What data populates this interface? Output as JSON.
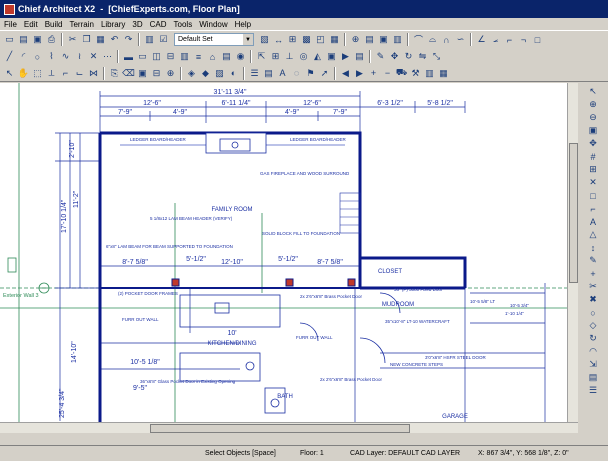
{
  "window": {
    "title": "Chief Architect X2",
    "title_suffix": "[ChiefExperts.com, Floor Plan]",
    "colors": {
      "titlebar": "#0a246a",
      "plan_lines": "#1b2fa3",
      "walls": "#0b1a8a",
      "dimensions": "#1b2fa3",
      "green_guides": "#2e8b57",
      "red_marker": "#c0392b"
    }
  },
  "menu": [
    "File",
    "Edit",
    "Build",
    "Terrain",
    "Library",
    "3D",
    "CAD",
    "Tools",
    "Window",
    "Help"
  ],
  "toolbar": {
    "layer_select": "Default Set"
  },
  "plan": {
    "dimensions_top": {
      "overall": "31'-11 3/4\"",
      "row2_left": "12'-6\"",
      "row2_mid": "6'-11 1/4\"",
      "row2_right": "12'-6\"",
      "row2_far_right": "6'-3 1/2\"",
      "row2_far_right2": "5'-8 1/2\"",
      "row3_a": "7'-9\"",
      "row3_b": "4'-9\"",
      "row3_c": "4'-9\"",
      "row3_d": "7'-9\""
    },
    "dimensions_left": {
      "a": "2'-10\"",
      "b": "11'-2\"",
      "c": "17'-10 1/4\"",
      "d": "14'-10\"",
      "e": "25'-4 3/4\""
    },
    "dimensions_mid": {
      "a": "8'-7 5/8\"",
      "b": "5'-1/2\"",
      "c": "12'-10\"",
      "d": "5'-1/2\"",
      "e": "8'-7 5/8\"",
      "f": "10'-5 1/8\"",
      "g": "10'",
      "h": "9'-5\""
    },
    "room_labels": {
      "family_room": "FAMILY ROOM",
      "kitchen": "KITCHEN/DINING",
      "closet": "CLOSET",
      "mudroom": "MUDROOM",
      "garage": "GARAGE",
      "bath": "BATH"
    },
    "notes": {
      "header_top": "LEDGER BOARD/HEADER",
      "header_top2": "LEDGER BOARD/HEADER",
      "fireplace": "GAS FIREPLACE AND WOOD SURROUND",
      "lam_beam": "5 1/8x12 LAM BEAM HEADER (VERIFY)",
      "block_fill": "SOLID BLOCK FILL TO FOUNDATION",
      "lam_beam2": "6\"x8\" LAM BEAM FOR BEAM SUPPORTED TO FOUNDATION",
      "pocket_a": "(2) POCKET DOOR FRAMES",
      "furr_wall": "FURR OUT WALL",
      "furr_wall2": "FURR OUT WALL",
      "pocket_b": "2x 2'6\"x6'8\" Brass Pocket Door",
      "pocket_c": "36\"x6'8\" Glass Pocket Door in Existing Opening",
      "mudroom_door": "36\" (P) 3080 Fixed Door",
      "lt": "10'-5 5/8\" LT",
      "water_craft": "35\"x10'-8\" LT-10 WATERCRAFT",
      "new_steps": "NEW CONCRETE STEPS",
      "new_door": "3'0\"x6'8\" HSFR STEEL DOOR",
      "pocket_d": "2x 2'6\"x6'8\" Brass Pocket Door",
      "dim_r1": "10'-5 3/4\"",
      "dim_r2": "1'-10 1/4\"",
      "left_label": "Exterior Wall 3"
    }
  },
  "status": {
    "mode": "Select Objects [Space]",
    "floor": "Floor: 1",
    "layer": "CAD Layer:  DEFAULT CAD LAYER",
    "coords": "X: 867 3/4\", Y: 568 1/8\", Z: 0\""
  }
}
